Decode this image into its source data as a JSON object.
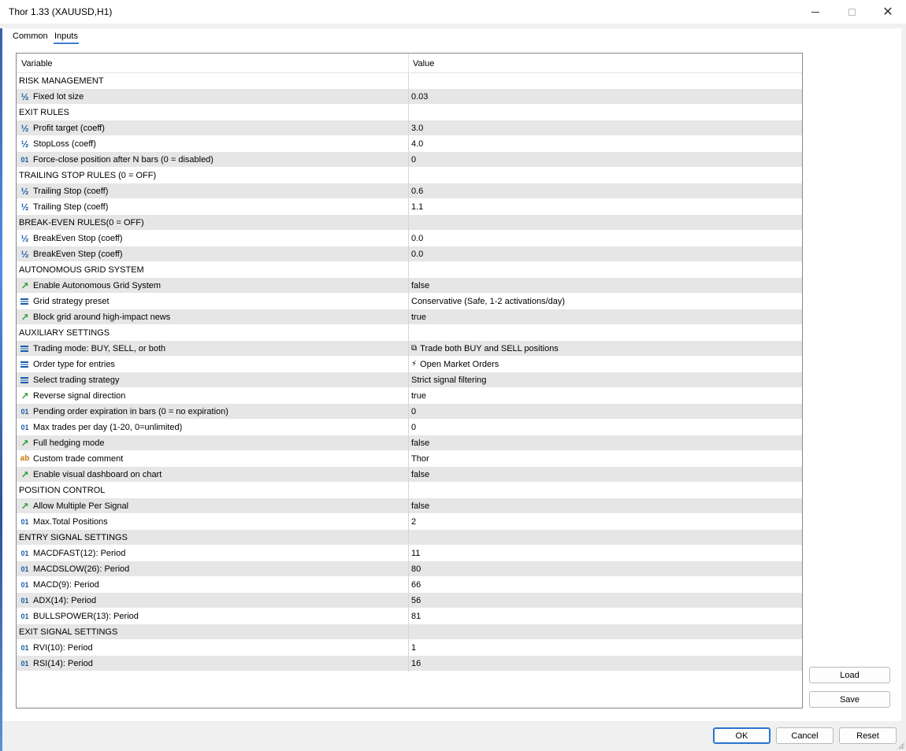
{
  "window": {
    "title": "Thor 1.33 (XAUUSD,H1)"
  },
  "tabs": [
    {
      "label": "Common",
      "active": false
    },
    {
      "label": "Inputs",
      "active": true
    }
  ],
  "grid": {
    "headers": {
      "variable": "Variable",
      "value": "Value"
    },
    "rows": [
      {
        "type": "section",
        "label": "RISK MANAGEMENT",
        "value": ""
      },
      {
        "type": "double",
        "icon": "half-icon",
        "label": "Fixed lot size",
        "value": "0.03"
      },
      {
        "type": "section",
        "label": "EXIT RULES",
        "value": ""
      },
      {
        "type": "double",
        "icon": "half-icon",
        "label": "Profit target (coeff)",
        "value": "3.0"
      },
      {
        "type": "double",
        "icon": "half-icon",
        "label": "StopLoss (coeff)",
        "value": "4.0"
      },
      {
        "type": "int",
        "icon": "integer-icon",
        "label": "Force-close position after N bars (0 = disabled)",
        "value": "0"
      },
      {
        "type": "section",
        "label": "TRAILING STOP RULES (0 = OFF)",
        "value": ""
      },
      {
        "type": "double",
        "icon": "half-icon",
        "label": "Trailing Stop (coeff)",
        "value": "0.6"
      },
      {
        "type": "double",
        "icon": "half-icon",
        "label": "Trailing Step (coeff)",
        "value": "1.1"
      },
      {
        "type": "section",
        "label": "BREAK-EVEN RULES(0 = OFF)",
        "value": ""
      },
      {
        "type": "double",
        "icon": "half-icon",
        "label": "BreakEven Stop (coeff)",
        "value": "0.0"
      },
      {
        "type": "double",
        "icon": "half-icon",
        "label": "BreakEven Step (coeff)",
        "value": "0.0"
      },
      {
        "type": "section",
        "label": "AUTONOMOUS GRID SYSTEM",
        "value": ""
      },
      {
        "type": "bool",
        "icon": "boolean-icon",
        "label": "Enable Autonomous Grid System",
        "value": "false"
      },
      {
        "type": "enum",
        "icon": "enum-icon",
        "label": "Grid strategy preset",
        "value": "Conservative (Safe, 1-2 activations/day)"
      },
      {
        "type": "bool",
        "icon": "boolean-icon",
        "label": "Block grid around high-impact news",
        "value": "true"
      },
      {
        "type": "section",
        "label": "AUXILIARY SETTINGS",
        "value": ""
      },
      {
        "type": "enum",
        "icon": "enum-icon",
        "label": "Trading mode: BUY, SELL, or both",
        "value": "Trade both BUY and SELL positions",
        "value_icon": "⧉"
      },
      {
        "type": "enum",
        "icon": "enum-icon",
        "label": "Order type for entries",
        "value": "Open Market Orders",
        "value_icon": "⚡"
      },
      {
        "type": "enum",
        "icon": "enum-icon",
        "label": "Select trading strategy",
        "value": "Strict signal filtering"
      },
      {
        "type": "bool",
        "icon": "boolean-icon",
        "label": "Reverse signal direction",
        "value": "true"
      },
      {
        "type": "int",
        "icon": "integer-icon",
        "label": "Pending order expiration in bars (0 = no expiration)",
        "value": "0"
      },
      {
        "type": "int",
        "icon": "integer-icon",
        "label": "Max trades per day (1-20, 0=unlimited)",
        "value": "0"
      },
      {
        "type": "bool",
        "icon": "boolean-icon",
        "label": "Full hedging mode",
        "value": "false"
      },
      {
        "type": "string",
        "icon": "string-icon",
        "label": "Custom trade comment",
        "value": "Thor"
      },
      {
        "type": "bool",
        "icon": "boolean-icon",
        "label": "Enable visual dashboard on chart",
        "value": "false"
      },
      {
        "type": "section",
        "label": "POSITION CONTROL",
        "value": ""
      },
      {
        "type": "bool",
        "icon": "boolean-icon",
        "label": "Allow Multiple Per Signal",
        "value": "false"
      },
      {
        "type": "int",
        "icon": "integer-icon",
        "label": "Max.Total Positions",
        "value": "2"
      },
      {
        "type": "section",
        "label": "ENTRY SIGNAL SETTINGS",
        "value": ""
      },
      {
        "type": "int",
        "icon": "integer-icon",
        "label": "MACDFAST(12): Period",
        "value": "11"
      },
      {
        "type": "int",
        "icon": "integer-icon",
        "label": "MACDSLOW(26): Period",
        "value": "80"
      },
      {
        "type": "int",
        "icon": "integer-icon",
        "label": "MACD(9): Period",
        "value": "66"
      },
      {
        "type": "int",
        "icon": "integer-icon",
        "label": "ADX(14): Period",
        "value": "56"
      },
      {
        "type": "int",
        "icon": "integer-icon",
        "label": "BULLSPOWER(13): Period",
        "value": "81"
      },
      {
        "type": "section",
        "label": "EXIT SIGNAL SETTINGS",
        "value": ""
      },
      {
        "type": "int",
        "icon": "integer-icon",
        "label": "RVI(10): Period",
        "value": "1"
      },
      {
        "type": "int",
        "icon": "integer-icon",
        "label": "RSI(14): Period",
        "value": "16"
      }
    ]
  },
  "side_buttons": {
    "load": "Load",
    "save": "Save"
  },
  "dialog_buttons": {
    "ok": "OK",
    "cancel": "Cancel",
    "reset": "Reset"
  },
  "icon_glyphs": {
    "half": "½",
    "int": "01",
    "bool": "↗",
    "string": "ab"
  },
  "colors": {
    "accent": "#3c7fd0",
    "icon_blue": "#1a5aa8",
    "icon_green": "#2e9c2e",
    "icon_orange": "#c97a00",
    "row_alt": "#e6e6e6"
  }
}
